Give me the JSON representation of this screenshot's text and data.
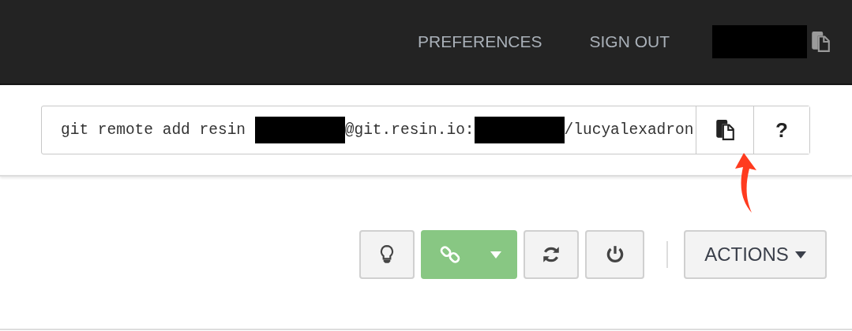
{
  "nav": {
    "links": [
      {
        "label": "PREFERENCES"
      },
      {
        "label": "SIGN OUT"
      }
    ],
    "user": {
      "kind": "redacted"
    }
  },
  "command": {
    "parts": [
      {
        "kind": "text",
        "text": "git remote add resin "
      },
      {
        "kind": "redacted"
      },
      {
        "kind": "text",
        "text": "@git.resin.io:"
      },
      {
        "kind": "redacted"
      },
      {
        "kind": "text",
        "text": "/lucyalexadron"
      }
    ],
    "help": "?"
  },
  "toolbar": {
    "actions": "ACTIONS"
  },
  "annotation": {
    "kind": "arrow",
    "color": "#ff3b1f"
  }
}
